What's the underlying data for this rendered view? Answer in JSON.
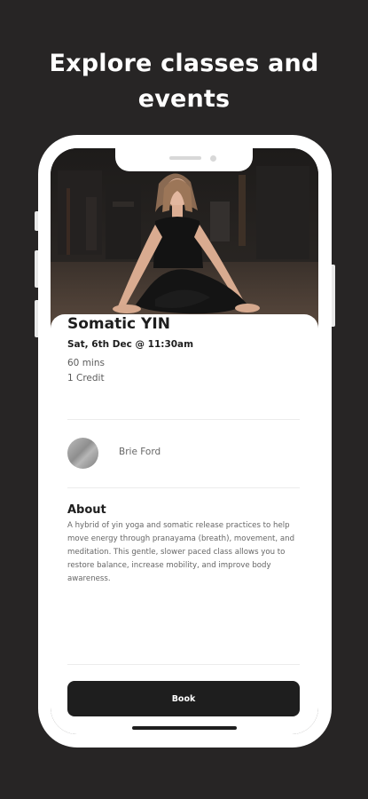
{
  "headline": {
    "line1": "Explore classes and",
    "line2": "events"
  },
  "class": {
    "title": "Somatic YIN",
    "datetime": "Sat, 6th Dec @ 11:30am",
    "duration": "60 mins",
    "credits": "1 Credit"
  },
  "instructor": {
    "name": "Brie Ford"
  },
  "about": {
    "heading": "About",
    "body": "A hybrid of yin yoga and somatic release practices to help move energy through pranayama (breath), movement, and meditation. This gentle, slower paced class allows you to restore balance, increase mobility, and improve body awareness."
  },
  "actions": {
    "book_label": "Book"
  }
}
